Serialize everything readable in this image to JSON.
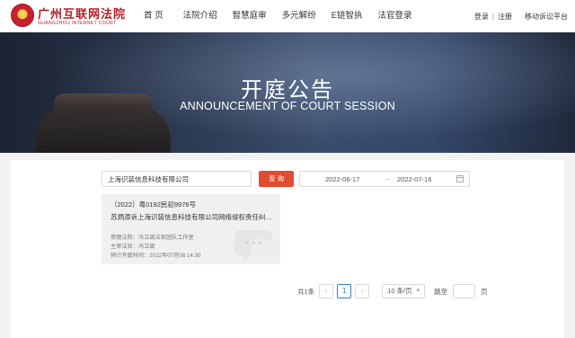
{
  "header": {
    "logo_cn": "广州互联网法院",
    "logo_en": "GUANGZHOU INTERNET COURT",
    "nav": [
      "首 页",
      "法院介绍",
      "智慧庭审",
      "多元解纷",
      "E链智执",
      "法官登录"
    ],
    "login": "登录",
    "separator": "|",
    "register": "注册",
    "mobile_platform": "移动诉讼平台"
  },
  "banner": {
    "title_cn": "开庭公告",
    "title_en": "ANNOUNCEMENT OF COURT SESSION"
  },
  "search": {
    "keyword_value": "上海识装信息科技有限公司",
    "button_label": "查 询",
    "date_start": "2022-06-17",
    "date_separator": "~",
    "date_end": "2022-07-16"
  },
  "results": [
    {
      "case_no": "（2022）粤0192民初9976号",
      "title": "苏炳添诉上海识装信息科技有限公司网络侵权责任纠纷...",
      "court_label": "审理法院：冯立斌法官团队工作室",
      "judge_label": "主审法官：冯立斌",
      "time_label": "预计开庭时间：2022年07月08 14:30"
    }
  ],
  "pagination": {
    "total": "共1条",
    "prev_icon": "‹",
    "current_page": "1",
    "next_icon": "›",
    "page_size": "10 条/页",
    "jump_label": "跳至",
    "page_suffix": "页"
  },
  "colors": {
    "accent": "#e04c2f",
    "brand": "#b51c24",
    "pagination_active": "#3a7bd5"
  }
}
